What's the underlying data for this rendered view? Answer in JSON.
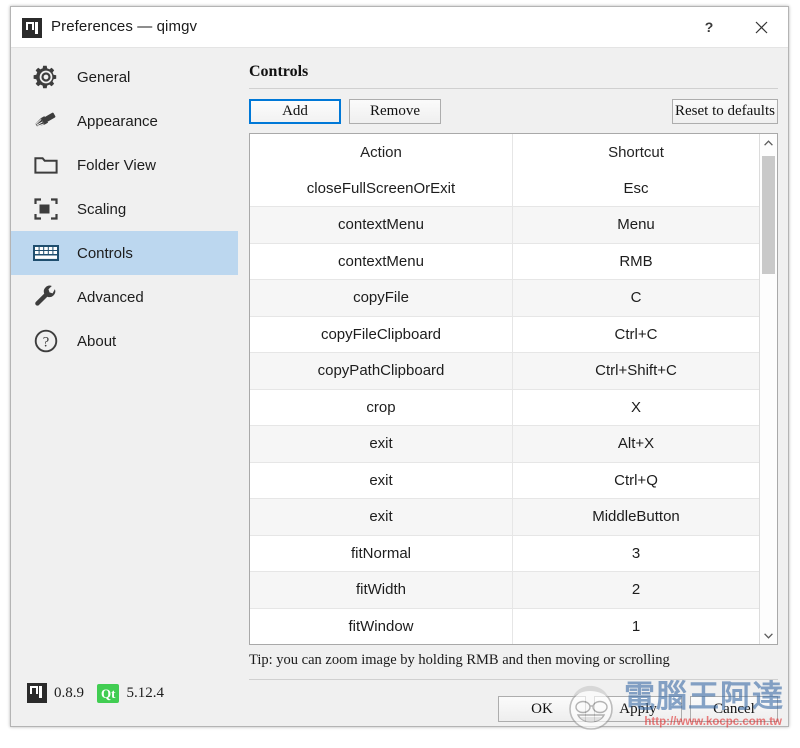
{
  "window": {
    "title": "Preferences — qimgv",
    "app_icon": "qimgv-app-icon",
    "help_button": "?",
    "close_button": "×"
  },
  "sidebar": {
    "items": [
      {
        "label": "General",
        "icon": "gear-icon",
        "selected": false
      },
      {
        "label": "Appearance",
        "icon": "paintbrush-icon",
        "selected": false
      },
      {
        "label": "Folder View",
        "icon": "folder-icon",
        "selected": false
      },
      {
        "label": "Scaling",
        "icon": "scaling-icon",
        "selected": false
      },
      {
        "label": "Controls",
        "icon": "keyboard-icon",
        "selected": true
      },
      {
        "label": "Advanced",
        "icon": "wrench-icon",
        "selected": false
      },
      {
        "label": "About",
        "icon": "question-circle-icon",
        "selected": false
      }
    ],
    "selected_color": "#bcd7ef"
  },
  "version_bar": {
    "app_version": "0.8.9",
    "qt_badge": "Qt",
    "qt_version": "5.12.4"
  },
  "main": {
    "section_title": "Controls",
    "toolbar": {
      "add_label": "Add",
      "remove_label": "Remove",
      "reset_label": "Reset to defaults",
      "focus_color": "#0078d7"
    },
    "table": {
      "columns": [
        "Action",
        "Shortcut"
      ],
      "rows": [
        {
          "action": "closeFullScreenOrExit",
          "shortcut": "Esc"
        },
        {
          "action": "contextMenu",
          "shortcut": "Menu"
        },
        {
          "action": "contextMenu",
          "shortcut": "RMB"
        },
        {
          "action": "copyFile",
          "shortcut": "C"
        },
        {
          "action": "copyFileClipboard",
          "shortcut": "Ctrl+C"
        },
        {
          "action": "copyPathClipboard",
          "shortcut": "Ctrl+Shift+C"
        },
        {
          "action": "crop",
          "shortcut": "X"
        },
        {
          "action": "exit",
          "shortcut": "Alt+X"
        },
        {
          "action": "exit",
          "shortcut": "Ctrl+Q"
        },
        {
          "action": "exit",
          "shortcut": "MiddleButton"
        },
        {
          "action": "fitNormal",
          "shortcut": "3"
        },
        {
          "action": "fitWidth",
          "shortcut": "2"
        },
        {
          "action": "fitWindow",
          "shortcut": "1"
        }
      ],
      "scrollbar": {
        "up_arrow": "⌃",
        "down_arrow": "⌄"
      }
    },
    "tip": "Tip: you can zoom image by holding RMB and then moving or scrolling"
  },
  "dialog_buttons": {
    "ok": "OK",
    "apply": "Apply",
    "cancel": "Cancel"
  },
  "watermark": {
    "text": "電腦王阿達",
    "url": "http://www.kocpc.com.tw"
  }
}
